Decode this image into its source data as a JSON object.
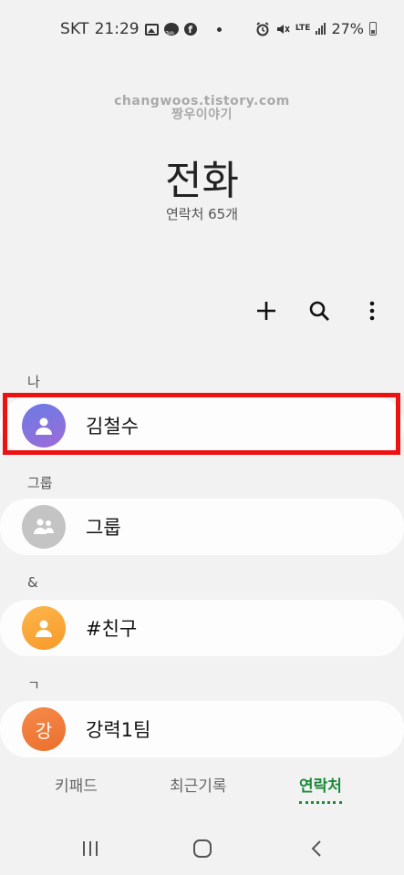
{
  "status_bar": {
    "carrier": "SKT",
    "time": "21:29",
    "network": "LTE",
    "battery": "27%",
    "icons_left": [
      "gallery-icon",
      "kakaotalk-icon",
      "facebook-icon",
      "dot-icon"
    ],
    "icons_right": [
      "alarm-icon",
      "mute-icon",
      "lte-icon",
      "signal-icon",
      "battery-icon"
    ]
  },
  "watermark": {
    "line1": "changwoos.tistory.com",
    "line2": "짱우이야기"
  },
  "header": {
    "title": "전화",
    "subtitle": "연락처 65개"
  },
  "toolbar": {
    "add_icon": "plus-icon",
    "search_icon": "search-icon",
    "more_icon": "more-vertical-icon"
  },
  "sections": [
    {
      "label": "나",
      "contacts": [
        {
          "name": "김철수",
          "avatar": "person-icon"
        }
      ]
    },
    {
      "label": "그룹",
      "contacts": [
        {
          "name": "그룹",
          "avatar": "group-icon"
        }
      ]
    },
    {
      "label": "&",
      "contacts": [
        {
          "name": "#친구",
          "avatar": "person-icon"
        }
      ]
    },
    {
      "label": "ㄱ",
      "contacts": [
        {
          "name": "강력1팀",
          "avatar_letter": "강"
        }
      ]
    }
  ],
  "tabs": [
    {
      "label": "키패드"
    },
    {
      "label": "최근기록"
    },
    {
      "label": "연락처",
      "active": true
    }
  ],
  "colors": {
    "accent": "#1c8a3c",
    "highlight": "#ee1111",
    "background": "#f2f2f2"
  }
}
